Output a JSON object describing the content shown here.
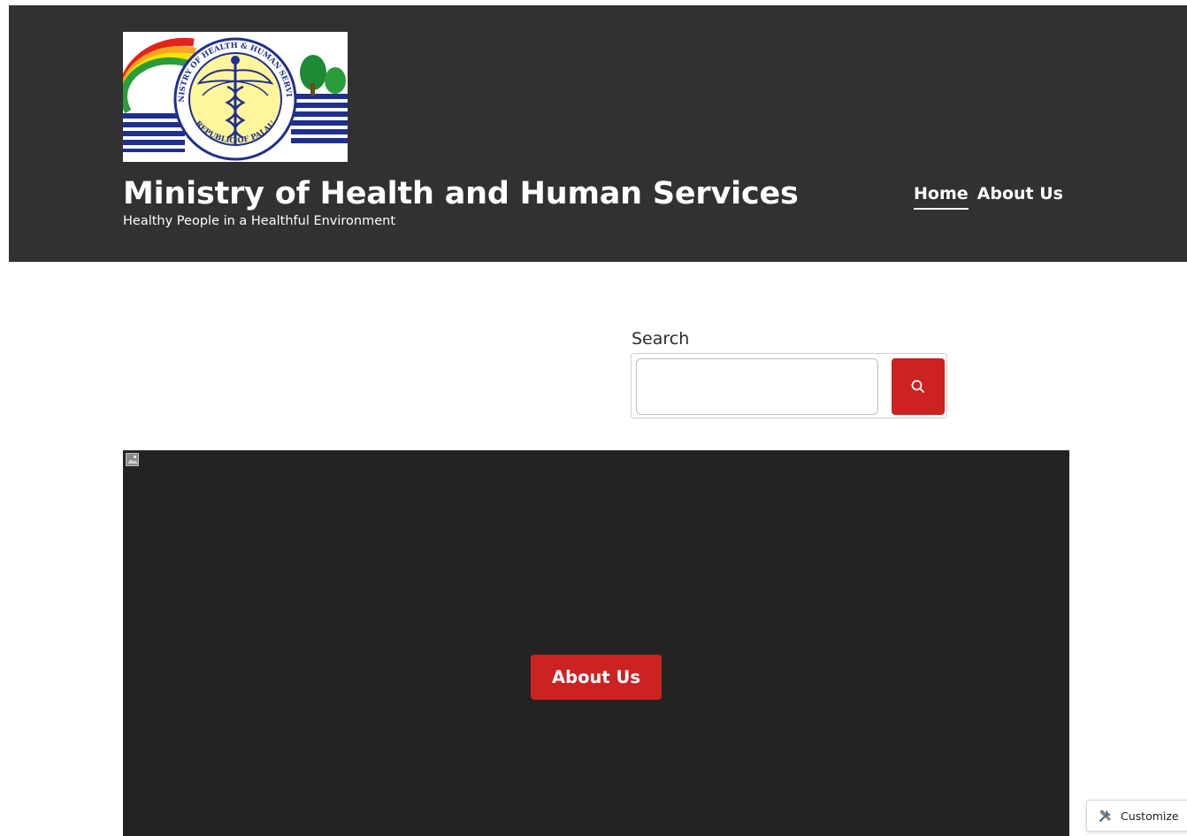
{
  "header": {
    "logo": {
      "ring_top_text": "MINISTRY OF HEALTH & HUMAN SERVICES",
      "ring_bottom_text": "REPUBLIC OF PALAU"
    },
    "site_title": "Ministry of Health and Human Services",
    "tagline": "Healthy People in a Healthful Environment",
    "nav": {
      "items": [
        {
          "label": "Home",
          "active": true
        },
        {
          "label": "About Us",
          "active": false
        }
      ]
    },
    "background_color": "#313131"
  },
  "search": {
    "label": "Search",
    "value": "",
    "placeholder": "",
    "button_icon": "search-icon",
    "button_color": "#cc2222"
  },
  "cover": {
    "background_color": "#232323",
    "image_icon": "broken-image-icon",
    "button_label": "About Us",
    "button_color": "#cc2222"
  },
  "customize_bar": {
    "icon": "customize-tools-icon",
    "label": "Customize"
  }
}
